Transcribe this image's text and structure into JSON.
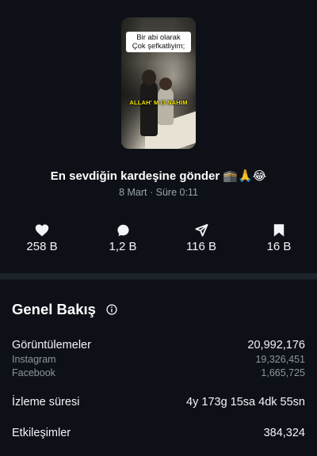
{
  "video": {
    "caption_line1": "Bir abi olarak",
    "caption_line2": "Çok şefkatliyim;",
    "overlay_text": "ALLAH' M G NAHIM",
    "title": "En sevdiğin kardeşine gönder 🕋🙏😂",
    "meta": "8 Mart · Süre 0:11"
  },
  "stats": {
    "likes": "258 B",
    "comments": "1,2 B",
    "shares": "116 B",
    "saves": "16 B"
  },
  "overview": {
    "title": "Genel Bakış",
    "views_label": "Görüntülemeler",
    "views_value": "20,992,176",
    "instagram_label": "Instagram",
    "instagram_value": "19,326,451",
    "facebook_label": "Facebook",
    "facebook_value": "1,665,725",
    "watch_time_label": "İzleme süresi",
    "watch_time_value": "4y 173g 15sa 4dk 55sn",
    "interactions_label": "Etkileşimler",
    "interactions_value": "384,324"
  },
  "colors": {
    "background": "#0d1117",
    "muted": "#8c959f",
    "divider": "#1d232b",
    "caption_yellow": "#f3e600"
  },
  "icons": [
    "heart-icon",
    "comment-icon",
    "share-icon",
    "bookmark-icon",
    "info-icon"
  ]
}
